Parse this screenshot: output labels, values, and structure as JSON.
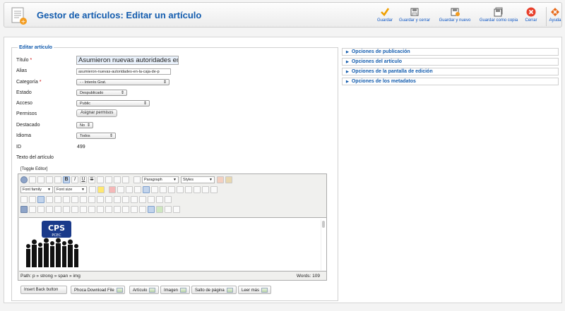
{
  "header": {
    "title": "Gestor de artículos: Editar un artículo",
    "buttons": {
      "guardar": "Guardar",
      "guardar_cerrar": "Guardar y cerrar",
      "guardar_nuevo": "Guardar y nuevo",
      "guardar_copia": "Guardar como copia",
      "cerrar": "Cerrar",
      "ayuda": "Ayuda"
    },
    "colors": {
      "title": "#135cae",
      "save": "#f0a000",
      "close": "#e8402c",
      "help": "#e86a1a"
    }
  },
  "form": {
    "legend": "Editar artículo",
    "titulo": {
      "label": "Título",
      "value": "Asumieron nuevas autoridades en"
    },
    "alias": {
      "label": "Alias",
      "value": "asumieron-nuevas-autoridades-en-la-caja-de-p"
    },
    "categoria": {
      "label": "Categoría",
      "value": "- - Interés Grat."
    },
    "estado": {
      "label": "Estado",
      "value": "Despublicado"
    },
    "acceso": {
      "label": "Acceso",
      "value": "Public"
    },
    "permisos": {
      "label": "Permisos",
      "button": "Asignar permisos"
    },
    "destacado": {
      "label": "Destacado",
      "value": "No"
    },
    "idioma": {
      "label": "Idioma",
      "value": "Todos"
    },
    "id": {
      "label": "ID",
      "value": "499"
    },
    "texto_label": "Texto del artículo",
    "required_mark": "*"
  },
  "editor": {
    "toggle": "[Toggle Editor]",
    "format_select": "Paragraph",
    "styles_select": "Styles",
    "font_family": "Font family",
    "font_size": "Font size",
    "bold": "B",
    "italic": "I",
    "underline": "U",
    "strike": "S",
    "logo_text_top": "CPS",
    "logo_text_bottom": "PCEC",
    "path": "Path: p » strong » span » img",
    "words": "Words: 109"
  },
  "extra_buttons": {
    "back": "Insert Back button",
    "phoca": "Phoca Download File",
    "articulo": "Artículo",
    "imagen": "Imagen",
    "salto": "Salto de página",
    "leer": "Leer más"
  },
  "panels": {
    "publicacion": "Opciones de publicación",
    "articulo": "Opciones del artículo",
    "pantalla": "Opciones de la pantalla de edición",
    "metadatos": "Opciones de los metadatos"
  }
}
